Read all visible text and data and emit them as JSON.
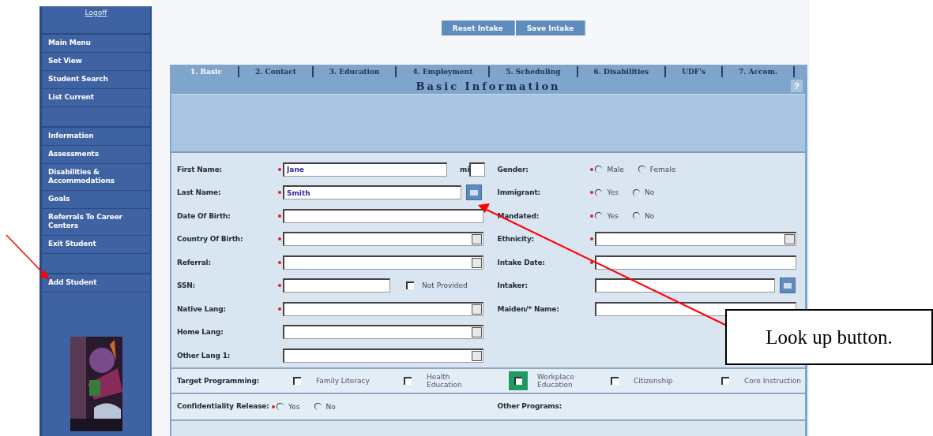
{
  "sidebar": {
    "logoff": "Logoff",
    "groups": [
      [
        "Main Menu",
        "Set View",
        "Student Search",
        "List Current"
      ],
      [
        "Information",
        "Assessments",
        "Disabilities & Accommodations",
        "Goals",
        "Referrals To Career Centers",
        "Exit Student"
      ],
      [
        "Add Student"
      ]
    ]
  },
  "toolbar": {
    "buttons": [
      "Reset Intake",
      "Save Intake"
    ]
  },
  "tabs": [
    {
      "label": "1. Basic",
      "selected": true
    },
    {
      "label": "2. Contact",
      "selected": false
    },
    {
      "label": "3. Education",
      "selected": false
    },
    {
      "label": "4. Employment",
      "selected": false
    },
    {
      "label": "5. Scheduling",
      "selected": false
    },
    {
      "label": "6. Disabilities",
      "selected": false
    },
    {
      "label": "UDF's",
      "selected": false
    },
    {
      "label": "7. Accom.",
      "selected": false
    }
  ],
  "panel": {
    "title": "Basic Information",
    "help": "?"
  },
  "form": {
    "left": [
      {
        "label": "First Name:",
        "required": true,
        "kind": "text-mi",
        "value": "Jane",
        "mi_label": "mi"
      },
      {
        "label": "Last Name:",
        "required": true,
        "kind": "lookup",
        "value": "Smith"
      },
      {
        "label": "Date Of Birth:",
        "required": true,
        "kind": "text"
      },
      {
        "label": "Country Of Birth:",
        "required": true,
        "kind": "select"
      },
      {
        "label": "Referral:",
        "required": true,
        "kind": "select"
      },
      {
        "label": "SSN:",
        "required": true,
        "kind": "text-check",
        "check": {
          "label": "Not Provided",
          "checked": false
        }
      },
      {
        "label": "Native Lang:",
        "required": true,
        "kind": "select"
      },
      {
        "label": "Home Lang:",
        "required": false,
        "kind": "select"
      },
      {
        "label": "Other Lang 1:",
        "required": false,
        "kind": "select"
      }
    ],
    "right": [
      {
        "label": "Gender:",
        "required": true,
        "kind": "radio",
        "options": [
          {
            "label": "Male",
            "selected": false
          },
          {
            "label": "Female",
            "selected": false
          }
        ]
      },
      {
        "label": "Immigrant:",
        "required": true,
        "kind": "radio",
        "options": [
          {
            "label": "Yes",
            "selected": false
          },
          {
            "label": "No",
            "selected": false
          }
        ]
      },
      {
        "label": "Mandated:",
        "required": true,
        "kind": "radio",
        "options": [
          {
            "label": "Yes",
            "selected": false
          },
          {
            "label": "No",
            "selected": false
          }
        ]
      },
      {
        "label": "Ethnicity:",
        "required": true,
        "kind": "select"
      },
      {
        "label": "Intake Date:",
        "required": true,
        "kind": "text"
      },
      {
        "label": "Intaker:",
        "required": false,
        "kind": "lookup"
      },
      {
        "label": "Maiden/* Name:",
        "required": false,
        "kind": "text"
      }
    ]
  },
  "target_programming": {
    "label": "Target Programming:",
    "options": [
      {
        "label": "Family Literacy",
        "checked": false,
        "focused": false
      },
      {
        "label": "Health Education",
        "checked": false,
        "focused": false
      },
      {
        "label": "Workplace Education",
        "checked": false,
        "focused": true
      },
      {
        "label": "Citizenship",
        "checked": false,
        "focused": false
      },
      {
        "label": "Core Instruction",
        "checked": false,
        "focused": false
      }
    ]
  },
  "confidentiality": {
    "label": "Confidentiality Release:",
    "required": true,
    "options": [
      {
        "label": "Yes",
        "selected": false
      },
      {
        "label": "No",
        "selected": false
      }
    ]
  },
  "other_programs": {
    "label": "Other Programs:"
  },
  "callout": {
    "text": "Look up button."
  }
}
